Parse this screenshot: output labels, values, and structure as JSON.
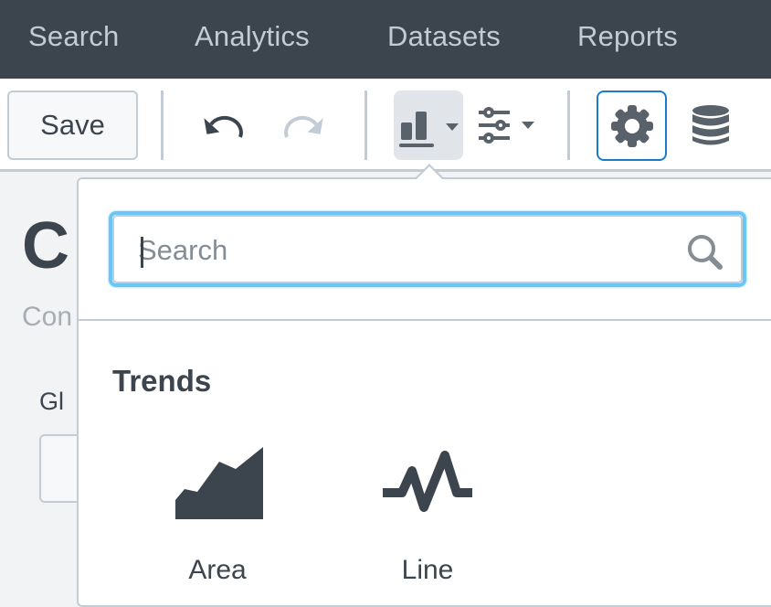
{
  "topnav": {
    "items": [
      {
        "label": "Search"
      },
      {
        "label": "Analytics"
      },
      {
        "label": "Datasets"
      },
      {
        "label": "Reports"
      }
    ]
  },
  "toolbar": {
    "save_label": "Save",
    "icons": {
      "undo": "undo-icon",
      "redo": "redo-icon",
      "visualization": "bar-chart-icon",
      "format": "sliders-icon",
      "settings": "gear-icon",
      "data": "database-icon"
    },
    "redo_enabled": false,
    "active_colors": {
      "focus_border": "#1a7cc5",
      "selected_bg": "#e1e5ea"
    }
  },
  "background_page": {
    "title_fragment": "C",
    "subtitle_fragment": "Con",
    "field_label_fragment": "Gl"
  },
  "viz_picker": {
    "search": {
      "value": "",
      "placeholder": "Search"
    },
    "sections": [
      {
        "title": "Trends",
        "items": [
          {
            "label": "Area",
            "icon": "area-chart-icon"
          },
          {
            "label": "Line",
            "icon": "line-chart-icon"
          }
        ]
      }
    ]
  },
  "colors": {
    "nav_bg": "#3c444d",
    "nav_text": "#c3cbd4",
    "text": "#3c444d",
    "border": "#c3cbd4",
    "search_focus": "#6cc6f5"
  }
}
